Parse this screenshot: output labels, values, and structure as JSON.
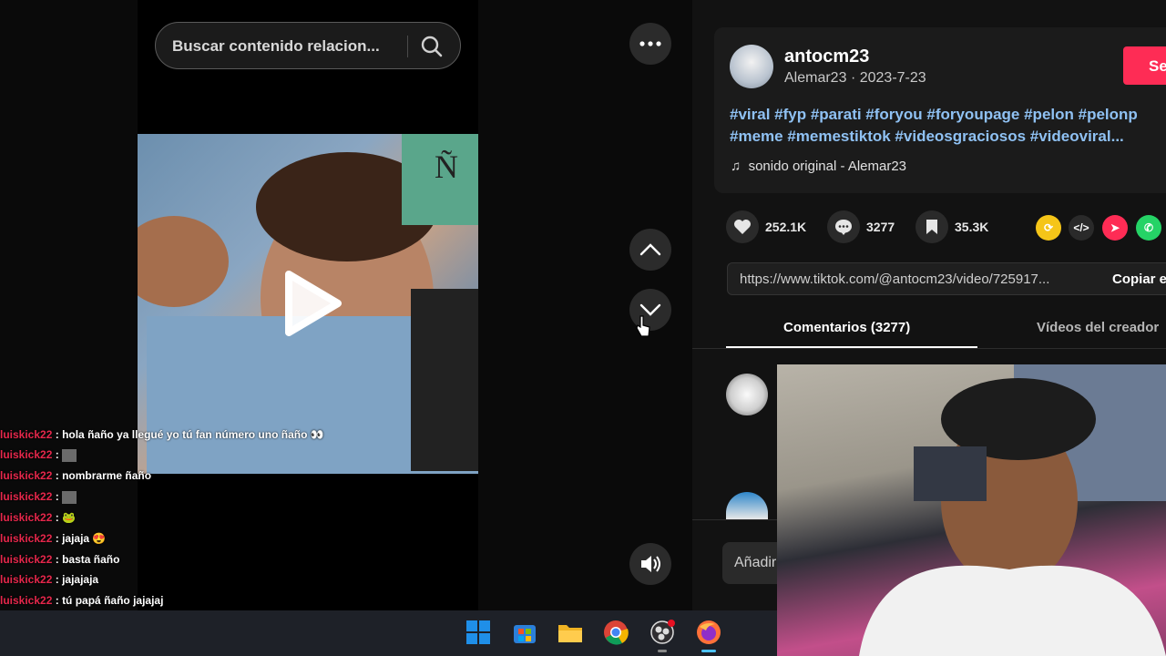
{
  "search": {
    "placeholder": "Buscar contenido relacion..."
  },
  "post": {
    "author": "antocm23",
    "nickname": "Alemar23",
    "date": "2023-7-23",
    "follow_label": "Se",
    "hashtags_line1": "#viral #fyp #parati #foryou #foryoupage #pelon #pelonp",
    "hashtags_line2": "#meme #memestiktok #videosgraciosos #videoviral...",
    "music": "sonido original - Alemar23"
  },
  "stats": {
    "likes": "252.1K",
    "comments": "3277",
    "saves": "35.3K"
  },
  "link": {
    "url": "https://www.tiktok.com/@antocm23/video/725917...",
    "copy_label": "Copiar e"
  },
  "tabs": {
    "comments": "Comentarios (3277)",
    "creator_videos": "Vídeos del creador"
  },
  "comment_input": {
    "placeholder": "Añadir"
  },
  "chat": [
    {
      "user": "luiskick22",
      "sep": ":",
      "msg": "hola ñaño ya llegué yo tú fan número uno ñaño 👀"
    },
    {
      "user": "luiskick22",
      "sep": ":",
      "msg": ""
    },
    {
      "user": "luiskick22",
      "sep": ":",
      "msg": "nombrarme ñaño"
    },
    {
      "user": "luiskick22",
      "sep": ":",
      "msg": ""
    },
    {
      "user": "luiskick22",
      "sep": ":",
      "msg": "🐸"
    },
    {
      "user": "luiskick22",
      "sep": ":",
      "msg": "jajaja 😍"
    },
    {
      "user": "luiskick22",
      "sep": ":",
      "msg": "basta ñaño"
    },
    {
      "user": "luiskick22",
      "sep": ":",
      "msg": "jajajaja"
    },
    {
      "user": "luiskick22",
      "sep": ":",
      "msg": "tú papá ñaño jajajaj"
    }
  ],
  "colors": {
    "accent": "#fe2c55",
    "hashtag": "#8fc1f3",
    "chat_user": "#e5274b",
    "active_tab": "#ffffff",
    "inactive_tab": "#b5b5b5"
  },
  "taskbar": {
    "icons": [
      "windows-start-icon",
      "microsoft-store-icon",
      "file-explorer-icon",
      "chrome-icon",
      "obs-icon",
      "firefox-icon"
    ]
  }
}
